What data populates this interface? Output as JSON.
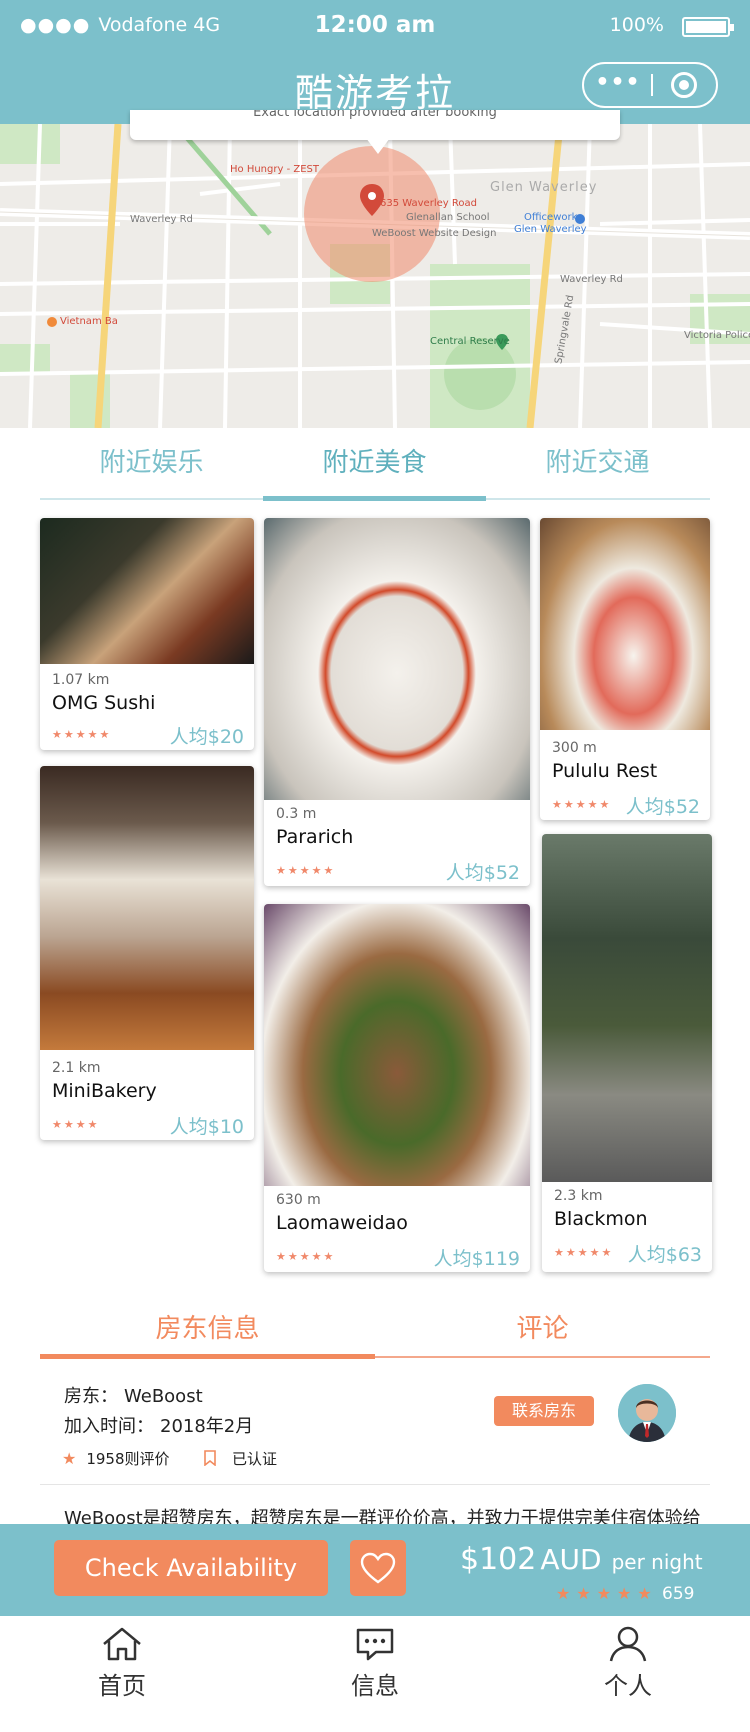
{
  "status_bar": {
    "carrier": "Vodafone 4G",
    "signal": "●●●●",
    "time": "12:00 am",
    "battery": "100%"
  },
  "header": {
    "title": "酷游考拉",
    "more_icon": "•••",
    "target_icon": "record-icon"
  },
  "map": {
    "callout": "Exact location provided after booking",
    "labels": {
      "address": "635 Waverley Road",
      "school": "Glenallan School",
      "weboost": "WeBoost Website Design",
      "officeworks": "Officeworks",
      "officeworks_sub": "Glen Waverley",
      "suburb": "Glen Waverley",
      "central_reserve": "Central Reserve",
      "vietnam": "Vietnam Ba",
      "hungry": "Ho Hungry - ZEST",
      "victoria": "Victoria Police",
      "road1": "Waverley Rd",
      "road2": "Waverley Rd",
      "road3": "Springvale Rd"
    }
  },
  "category_tabs": [
    "附近娱乐",
    "附近美食",
    "附近交通"
  ],
  "active_category": 1,
  "restaurants": [
    {
      "distance": "1.07 km",
      "name": "OMG Sushi",
      "stars": "★★★★★",
      "price": "人均$20"
    },
    {
      "distance": "2.1 km",
      "name": "MiniBakery",
      "stars": "★★★★",
      "price": "人均$10"
    },
    {
      "distance": "0.3 m",
      "name": "Pararich",
      "stars": "★★★★★",
      "price": "人均$52"
    },
    {
      "distance": "630 m",
      "name": "Laomaweidao",
      "stars": "★★★★★",
      "price": "人均$119"
    },
    {
      "distance": "300 m",
      "name": "Pululu Rest",
      "stars": "★★★★★",
      "price": "人均$52"
    },
    {
      "distance": "2.3 km",
      "name": "Blackmon",
      "stars": "★★★★★",
      "price": "人均$63"
    }
  ],
  "host_tabs": [
    "房东信息",
    "评论"
  ],
  "host": {
    "host_label": "房东：",
    "host_name": "WeBoost",
    "joined_label": "加入时间：",
    "joined": "2018年2月",
    "reviews": "1958则评价",
    "verified": "已认证",
    "contact": "联系房东",
    "description": "WeBoost是超赞房东，超赞房东是一群评价价高，并致力于提供完美住宿体验给"
  },
  "booking": {
    "check_label": "Check Availability",
    "price": "$102",
    "currency": "AUD",
    "unit": "per night",
    "stars": "★★★★★",
    "review_count": "659"
  },
  "bottom_nav": [
    {
      "label": "首页",
      "icon": "home-icon"
    },
    {
      "label": "信息",
      "icon": "message-icon"
    },
    {
      "label": "个人",
      "icon": "person-icon"
    }
  ],
  "colors": {
    "teal": "#7cc0cb",
    "orange": "#f28a5e"
  }
}
